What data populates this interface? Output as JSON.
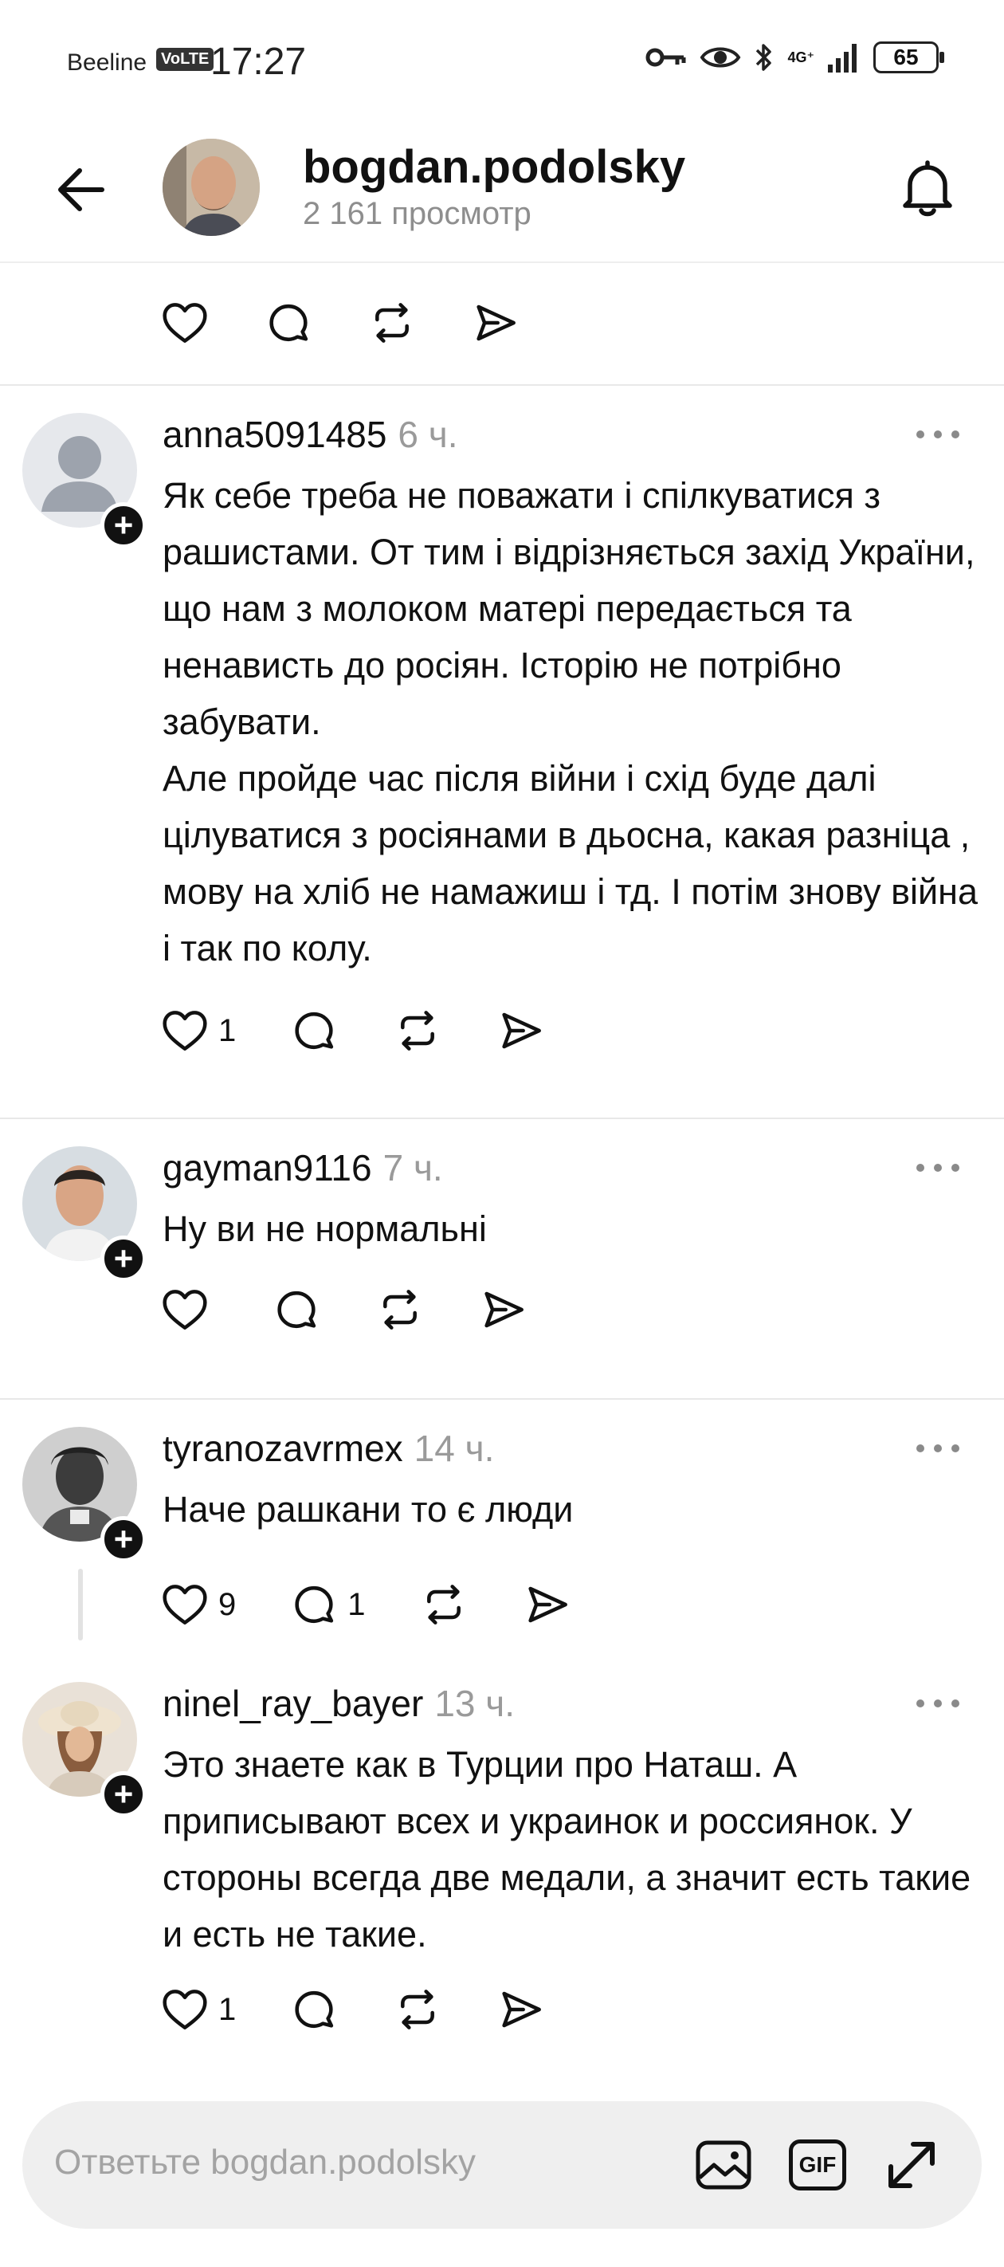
{
  "status_bar": {
    "carrier": "Beeline",
    "volte": "VoLTE",
    "time": "17:27",
    "network": "4G⁺",
    "battery": "65"
  },
  "header": {
    "username": "bogdan.podolsky",
    "views": "2 161 просмотр"
  },
  "comments": [
    {
      "username": "anna5091485",
      "time": "6 ч.",
      "text": "Як себе треба не поважати і спілкуватися з рашистами. От тим і відрізняється захід України, що нам з молоком матері передається та ненависть до росіян. Історію не потрібно забувати.\nАле пройде час після війни і схід буде далі цілуватися з росіянами в дьосна, какая разніца , мову на хліб не намажиш і тд. І потім знову війна і так по колу.",
      "likes": "1",
      "replies": ""
    },
    {
      "username": "gayman9116",
      "time": "7 ч.",
      "text": "Ну ви не нормальні",
      "likes": "",
      "replies": ""
    },
    {
      "username": "tyranozavrmex",
      "time": "14 ч.",
      "text": "Наче рашкани то є люди",
      "likes": "9",
      "replies": "1"
    },
    {
      "username": "ninel_ray_bayer",
      "time": "13 ч.",
      "text": "Это знаете как в Турции про Наташ. А приписывают всех и украинок и россиянок. У стороны всегда две медали, а значит есть такие и есть не такие.",
      "likes": "1",
      "replies": ""
    }
  ],
  "reply_bar": {
    "placeholder": "Ответьте bogdan.podolsky",
    "gif_label": "GIF"
  },
  "icons": {
    "back": "arrow-left-icon",
    "bell": "bell-icon",
    "like": "heart-icon",
    "reply": "comment-icon",
    "repost": "repost-icon",
    "share": "send-icon",
    "more": "more-icon",
    "image": "image-icon",
    "gif": "gif-icon",
    "expand": "expand-icon"
  },
  "colors": {
    "text": "#111111",
    "muted": "#9a9a9a",
    "separator": "#e8e8e8",
    "input_bg": "#efefef"
  }
}
